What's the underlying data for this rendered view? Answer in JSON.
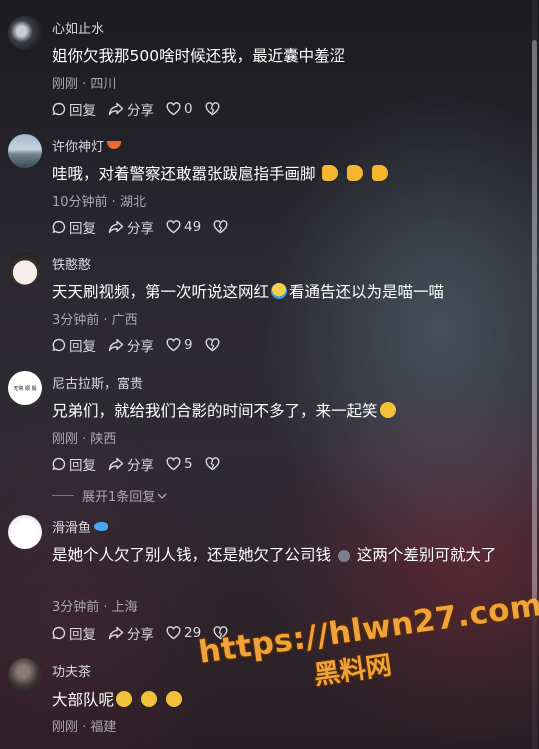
{
  "expand_replies": "展开1条回复",
  "watermark": {
    "url": "https://hlwn27.com",
    "cn": "黑料网"
  },
  "action_labels": {
    "reply": "回复",
    "share": "分享"
  },
  "comments": [
    {
      "name": "心如止水",
      "text": "姐你欠我那500啥时候还我，最近囊中羞涩",
      "meta": "刚刚 · 四川",
      "likes": "0"
    },
    {
      "name": "许你神灯",
      "text": "哇哦，对着警察还敢嚣张跋扈指手画脚",
      "meta": "10分钟前 · 湖北",
      "likes": "49"
    },
    {
      "name": "铁憨憨",
      "text_a": "天天刷视频，第一次听说这网红",
      "text_b": "看通告还以为是喵一喵",
      "meta": "3分钟前 · 广西",
      "likes": "9"
    },
    {
      "name": "尼古拉斯，富贵",
      "text": "兄弟们，就给我们合影的时间不多了，来一起笑",
      "meta": "刚刚 · 陕西",
      "likes": "5"
    },
    {
      "name": "滑滑鱼",
      "text_a": "是她个人欠了别人钱，还是她欠了公司钱",
      "text_b": "这两个差别可就大了",
      "meta": "3分钟前 · 上海",
      "likes": "29"
    },
    {
      "name": "功夫茶",
      "text": "大部队呢",
      "meta": "刚刚 · 福建"
    }
  ],
  "avatar_badge_text": "无常 顺 毁"
}
